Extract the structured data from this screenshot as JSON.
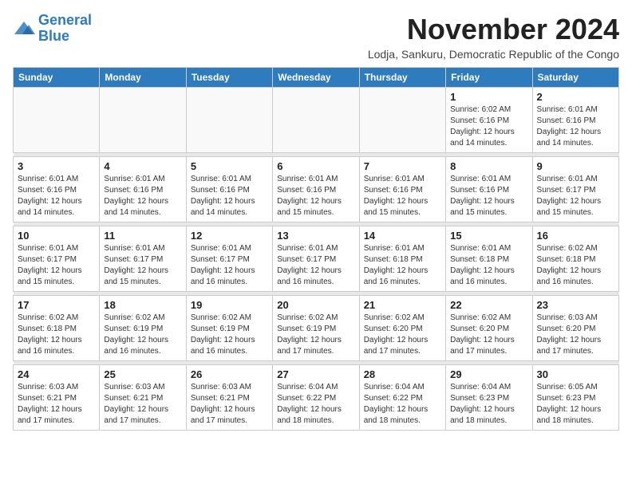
{
  "logo": {
    "line1": "General",
    "line2": "Blue"
  },
  "header": {
    "title": "November 2024",
    "subtitle": "Lodja, Sankuru, Democratic Republic of the Congo"
  },
  "days_of_week": [
    "Sunday",
    "Monday",
    "Tuesday",
    "Wednesday",
    "Thursday",
    "Friday",
    "Saturday"
  ],
  "weeks": [
    {
      "cells": [
        {
          "day": "",
          "info": ""
        },
        {
          "day": "",
          "info": ""
        },
        {
          "day": "",
          "info": ""
        },
        {
          "day": "",
          "info": ""
        },
        {
          "day": "",
          "info": ""
        },
        {
          "day": "1",
          "info": "Sunrise: 6:02 AM\nSunset: 6:16 PM\nDaylight: 12 hours and 14 minutes."
        },
        {
          "day": "2",
          "info": "Sunrise: 6:01 AM\nSunset: 6:16 PM\nDaylight: 12 hours and 14 minutes."
        }
      ]
    },
    {
      "cells": [
        {
          "day": "3",
          "info": "Sunrise: 6:01 AM\nSunset: 6:16 PM\nDaylight: 12 hours and 14 minutes."
        },
        {
          "day": "4",
          "info": "Sunrise: 6:01 AM\nSunset: 6:16 PM\nDaylight: 12 hours and 14 minutes."
        },
        {
          "day": "5",
          "info": "Sunrise: 6:01 AM\nSunset: 6:16 PM\nDaylight: 12 hours and 14 minutes."
        },
        {
          "day": "6",
          "info": "Sunrise: 6:01 AM\nSunset: 6:16 PM\nDaylight: 12 hours and 15 minutes."
        },
        {
          "day": "7",
          "info": "Sunrise: 6:01 AM\nSunset: 6:16 PM\nDaylight: 12 hours and 15 minutes."
        },
        {
          "day": "8",
          "info": "Sunrise: 6:01 AM\nSunset: 6:16 PM\nDaylight: 12 hours and 15 minutes."
        },
        {
          "day": "9",
          "info": "Sunrise: 6:01 AM\nSunset: 6:17 PM\nDaylight: 12 hours and 15 minutes."
        }
      ]
    },
    {
      "cells": [
        {
          "day": "10",
          "info": "Sunrise: 6:01 AM\nSunset: 6:17 PM\nDaylight: 12 hours and 15 minutes."
        },
        {
          "day": "11",
          "info": "Sunrise: 6:01 AM\nSunset: 6:17 PM\nDaylight: 12 hours and 15 minutes."
        },
        {
          "day": "12",
          "info": "Sunrise: 6:01 AM\nSunset: 6:17 PM\nDaylight: 12 hours and 16 minutes."
        },
        {
          "day": "13",
          "info": "Sunrise: 6:01 AM\nSunset: 6:17 PM\nDaylight: 12 hours and 16 minutes."
        },
        {
          "day": "14",
          "info": "Sunrise: 6:01 AM\nSunset: 6:18 PM\nDaylight: 12 hours and 16 minutes."
        },
        {
          "day": "15",
          "info": "Sunrise: 6:01 AM\nSunset: 6:18 PM\nDaylight: 12 hours and 16 minutes."
        },
        {
          "day": "16",
          "info": "Sunrise: 6:02 AM\nSunset: 6:18 PM\nDaylight: 12 hours and 16 minutes."
        }
      ]
    },
    {
      "cells": [
        {
          "day": "17",
          "info": "Sunrise: 6:02 AM\nSunset: 6:18 PM\nDaylight: 12 hours and 16 minutes."
        },
        {
          "day": "18",
          "info": "Sunrise: 6:02 AM\nSunset: 6:19 PM\nDaylight: 12 hours and 16 minutes."
        },
        {
          "day": "19",
          "info": "Sunrise: 6:02 AM\nSunset: 6:19 PM\nDaylight: 12 hours and 16 minutes."
        },
        {
          "day": "20",
          "info": "Sunrise: 6:02 AM\nSunset: 6:19 PM\nDaylight: 12 hours and 17 minutes."
        },
        {
          "day": "21",
          "info": "Sunrise: 6:02 AM\nSunset: 6:20 PM\nDaylight: 12 hours and 17 minutes."
        },
        {
          "day": "22",
          "info": "Sunrise: 6:02 AM\nSunset: 6:20 PM\nDaylight: 12 hours and 17 minutes."
        },
        {
          "day": "23",
          "info": "Sunrise: 6:03 AM\nSunset: 6:20 PM\nDaylight: 12 hours and 17 minutes."
        }
      ]
    },
    {
      "cells": [
        {
          "day": "24",
          "info": "Sunrise: 6:03 AM\nSunset: 6:21 PM\nDaylight: 12 hours and 17 minutes."
        },
        {
          "day": "25",
          "info": "Sunrise: 6:03 AM\nSunset: 6:21 PM\nDaylight: 12 hours and 17 minutes."
        },
        {
          "day": "26",
          "info": "Sunrise: 6:03 AM\nSunset: 6:21 PM\nDaylight: 12 hours and 17 minutes."
        },
        {
          "day": "27",
          "info": "Sunrise: 6:04 AM\nSunset: 6:22 PM\nDaylight: 12 hours and 18 minutes."
        },
        {
          "day": "28",
          "info": "Sunrise: 6:04 AM\nSunset: 6:22 PM\nDaylight: 12 hours and 18 minutes."
        },
        {
          "day": "29",
          "info": "Sunrise: 6:04 AM\nSunset: 6:23 PM\nDaylight: 12 hours and 18 minutes."
        },
        {
          "day": "30",
          "info": "Sunrise: 6:05 AM\nSunset: 6:23 PM\nDaylight: 12 hours and 18 minutes."
        }
      ]
    }
  ]
}
